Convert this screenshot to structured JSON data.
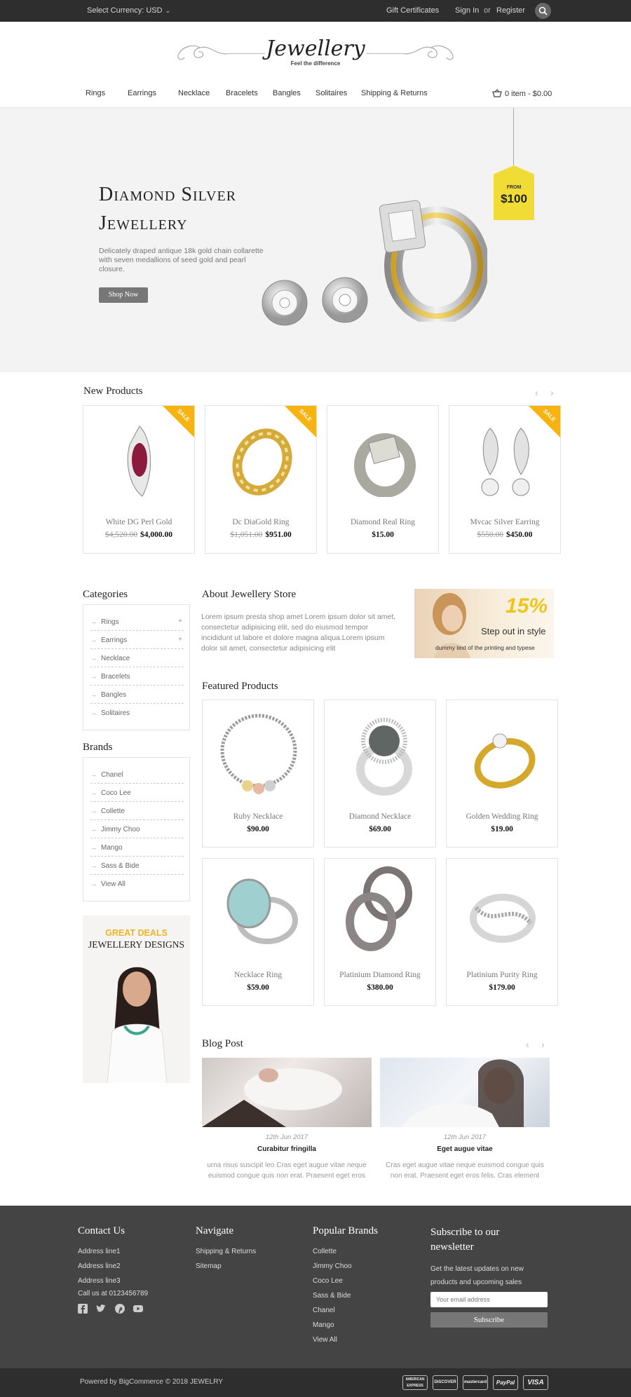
{
  "topbar": {
    "currency": "Select Currency: USD",
    "gift": "Gift Certificates",
    "signin": "Sign In",
    "or": "or",
    "register": "Register"
  },
  "logo": {
    "title": "Jewellery",
    "tagline": "Feel the difference"
  },
  "nav": {
    "items": [
      "Rings",
      "Earrings",
      "Necklace",
      "Bracelets",
      "Bangles",
      "Solitaires",
      "Shipping & Returns"
    ],
    "cart": "0 item - $0.00"
  },
  "hero": {
    "title_line1": "Diamond Silver",
    "title_line2": "Jewellery",
    "text": "Delicately draped antique 18k gold chain collarette with seven medallions of seed gold and pearl closure.",
    "button": "Shop Now",
    "tag_from": "FROM",
    "tag_price": "$100"
  },
  "new_products": {
    "title": "New Products",
    "sale_label": "SALE",
    "items": [
      {
        "name": "White DG Perl Gold",
        "old_price": "$4,520.00",
        "price": "$4,000.00"
      },
      {
        "name": "Dc DiaGold Ring",
        "old_price": "$1,051.00",
        "price": "$951.00"
      },
      {
        "name": "Diamond Real Ring",
        "old_price": "",
        "price": "$15.00"
      },
      {
        "name": "Mvcac Silver Earring",
        "old_price": "$550.00",
        "price": "$450.00"
      }
    ]
  },
  "categories": {
    "title": "Categories",
    "items": [
      "Rings",
      "Earrings",
      "Necklace",
      "Bracelets",
      "Bangles",
      "Solitaires"
    ]
  },
  "brands": {
    "title": "Brands",
    "items": [
      "Chanel",
      "Coco Lee",
      "Collette",
      "Jimmy Choo",
      "Mango",
      "Sass & Bide",
      "View All"
    ]
  },
  "deal": {
    "line1": "GREAT DEALS",
    "line2": "JEWELLERY DESIGNS"
  },
  "about": {
    "title": "About Jewellery Store",
    "text": "Lorem ipsum presta shop amet Lorem ipsum dolor sit amet, consectetur adipisicing elit, sed do eiusmod tempor incididunt ut labore et dolore magna aliqua.Lorem ipsum dolor sit amet, consectetur adipisicing elit"
  },
  "banner": {
    "percent": "15%",
    "step": "Step out in style",
    "dummy": "dummy text of the printing and typese"
  },
  "featured": {
    "title": "Featured Products",
    "items": [
      {
        "name": "Ruby Necklace",
        "price": "$90.00"
      },
      {
        "name": "Diamond Necklace",
        "price": "$69.00"
      },
      {
        "name": "Golden Wedding Ring",
        "price": "$19.00"
      },
      {
        "name": "Necklace Ring",
        "price": "$59.00"
      },
      {
        "name": "Platinium Diamond Ring",
        "price": "$380.00"
      },
      {
        "name": "Platinium Purity Ring",
        "price": "$179.00"
      }
    ]
  },
  "blog": {
    "title": "Blog Post",
    "posts": [
      {
        "date": "12th Jun 2017",
        "title": "Curabitur fringilla",
        "text": "urna risus suscipit leo Cras eget augue vitae neque euismod congue quis non erat. Praesent eget eros"
      },
      {
        "date": "12th Jun 2017",
        "title": "Eget augue vitae",
        "text": "Cras eget augue vitae neque euismod congue quis non erat. Praesent eget eros felis. Cras element"
      }
    ]
  },
  "footer": {
    "contact": {
      "title": "Contact Us",
      "lines": [
        "Address line1",
        "Address line2",
        "Address line3",
        "Call us at 0123456789"
      ]
    },
    "navigate": {
      "title": "Navigate",
      "links": [
        "Shipping & Returns",
        "Sitemap"
      ]
    },
    "brands": {
      "title": "Popular Brands",
      "links": [
        "Collette",
        "Jimmy Choo",
        "Coco Lee",
        "Sass & Bide",
        "Chanel",
        "Mango",
        "View All"
      ]
    },
    "newsletter": {
      "title_line1": "Subscribe to our",
      "title_line2": "newsletter",
      "text_line1": "Get the latest updates on new",
      "text_line2": "products and upcoming sales",
      "placeholder": "Your email address",
      "button": "Subscribe"
    },
    "copyright": "Powered by BigCommerce © 2018 JEWELRY",
    "payments": [
      "AMERICAN EXPRESS",
      "DISCOVER",
      "mastercard",
      "PayPal",
      "VISA"
    ]
  },
  "colors": {
    "accent": "#f6b311",
    "topbar": "#2e2e2e",
    "footer": "#444444",
    "button": "#777777"
  }
}
